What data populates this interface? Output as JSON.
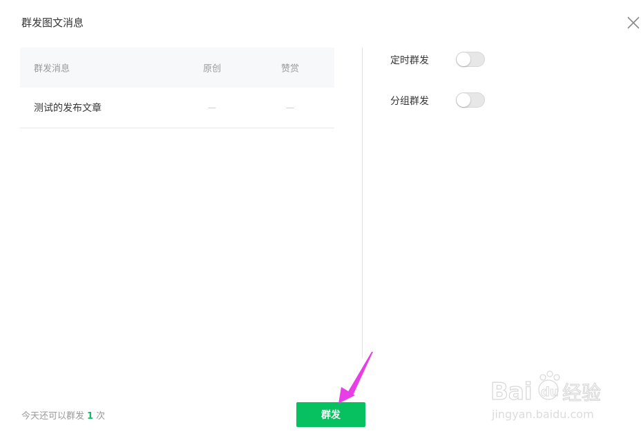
{
  "dialog": {
    "title": "群发图文消息"
  },
  "table": {
    "headers": {
      "title": "群发消息",
      "original": "原创",
      "reward": "赞赏"
    },
    "rows": [
      {
        "title": "测试的发布文章",
        "original": "—",
        "reward": "—"
      }
    ]
  },
  "options": {
    "scheduled": {
      "label": "定时群发",
      "enabled": false
    },
    "group": {
      "label": "分组群发",
      "enabled": false
    }
  },
  "footer": {
    "quota_prefix": "今天还可以群发",
    "quota_count": "1",
    "quota_suffix": "次",
    "send_label": "群发"
  },
  "colors": {
    "accent": "#07c160",
    "annotation_arrow": "#e83ee8"
  },
  "watermark": {
    "brand": "Baidu经验",
    "url": "jingyan.baidu.com"
  }
}
